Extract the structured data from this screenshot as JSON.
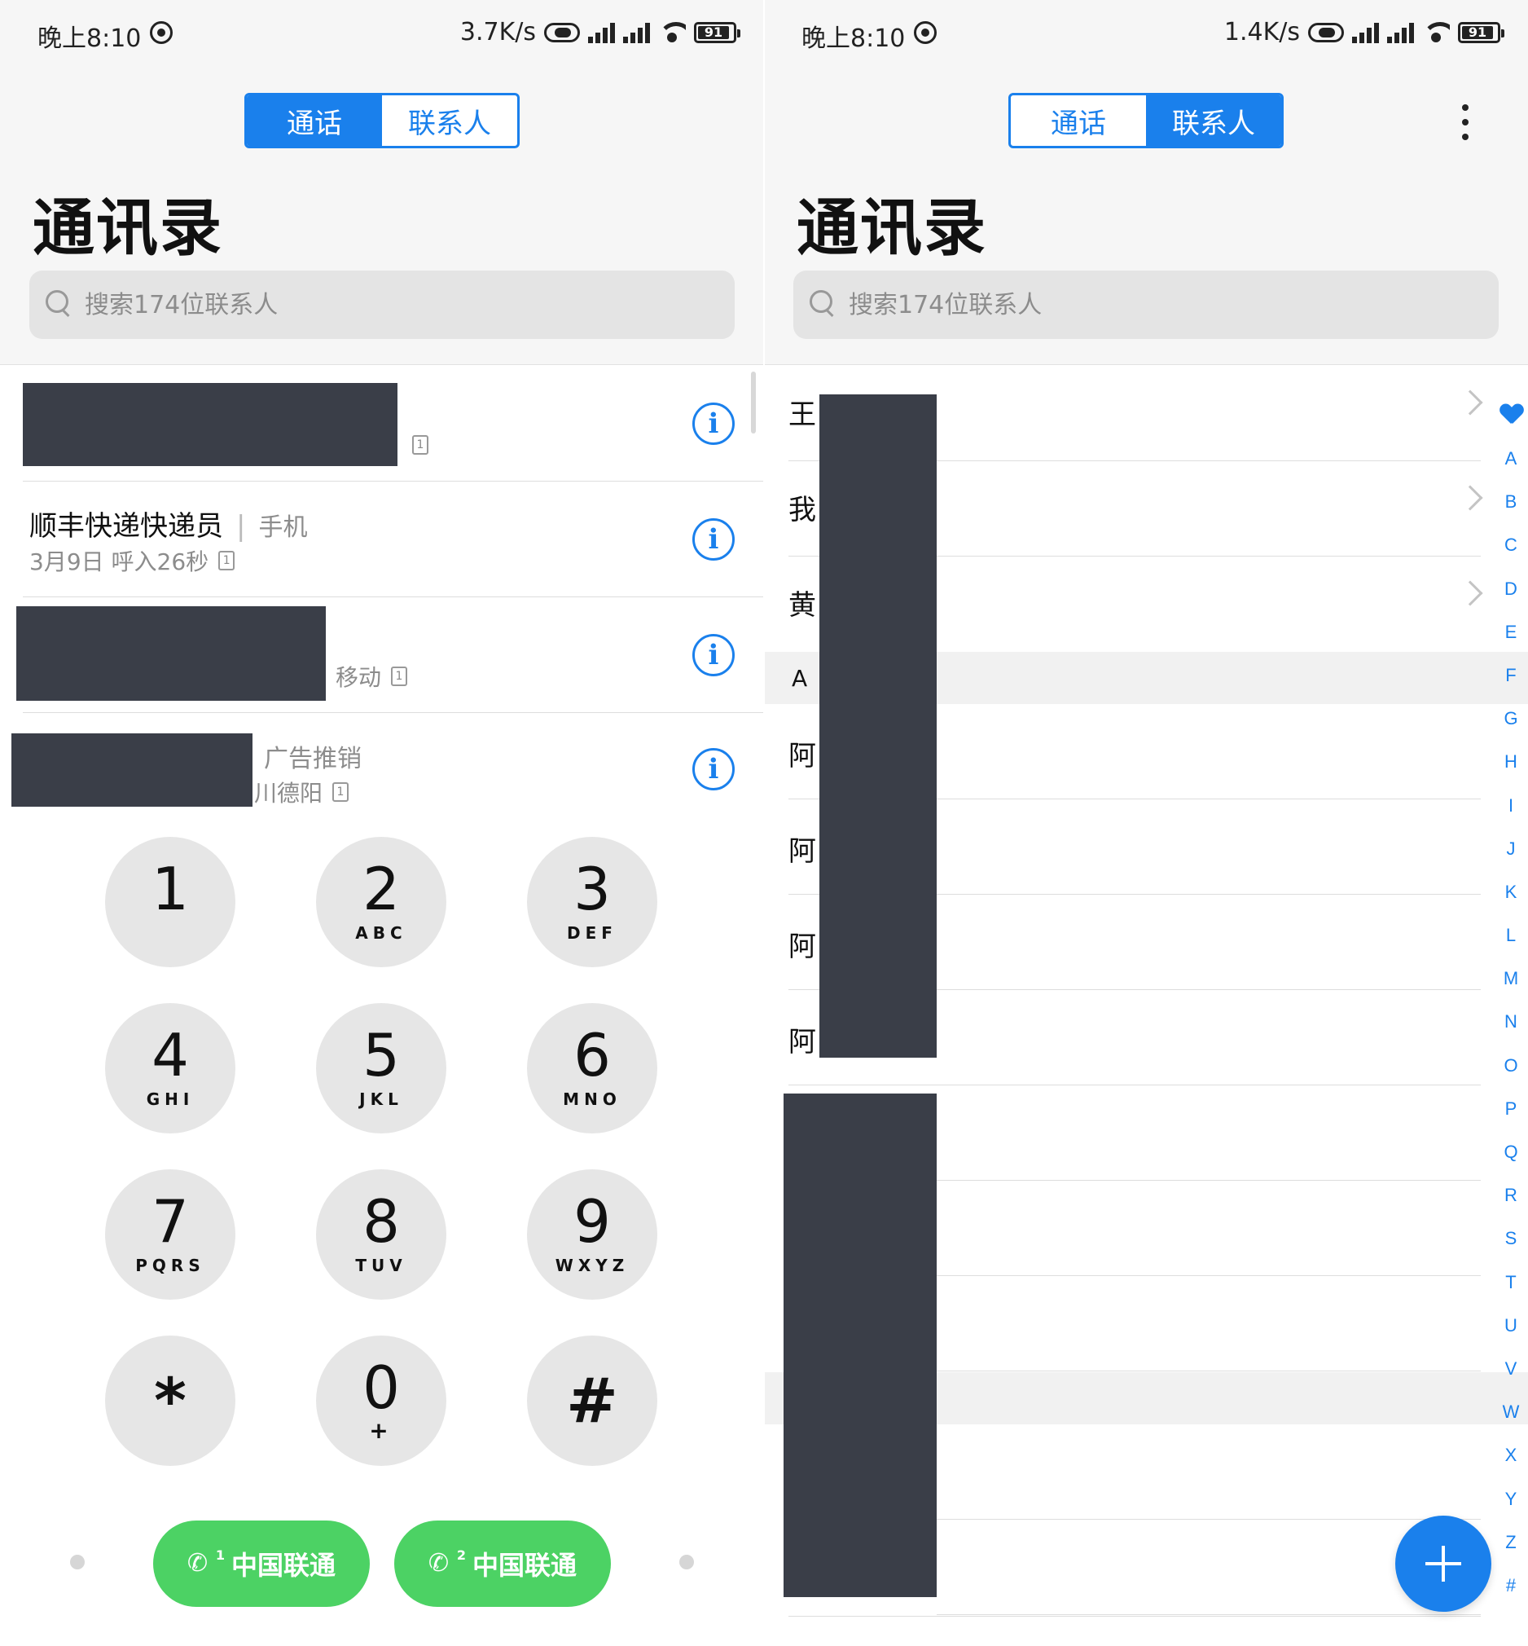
{
  "status_left": {
    "time": "晚上8:10",
    "speed": "3.7K/s",
    "battery": "91"
  },
  "status_right": {
    "time": "晚上8:10",
    "speed": "1.4K/s",
    "battery": "91"
  },
  "tabs": {
    "calls": "通话",
    "contacts": "联系人"
  },
  "title": "通讯录",
  "search": {
    "placeholder": "搜索174位联系人"
  },
  "call_log": [
    {
      "name": "",
      "type": "",
      "detail": "",
      "sim": "1"
    },
    {
      "name": "顺丰快递快递员",
      "type": "手机",
      "detail": "3月9日 呼入26秒",
      "sim": "1"
    },
    {
      "name": "",
      "type": "",
      "detail": "移动",
      "sim": "1"
    },
    {
      "name": "",
      "type": "广告推销",
      "detail": "川德阳",
      "sim": "1"
    }
  ],
  "keypad": [
    {
      "digit": "1",
      "letters": ""
    },
    {
      "digit": "2",
      "letters": "ABC"
    },
    {
      "digit": "3",
      "letters": "DEF"
    },
    {
      "digit": "4",
      "letters": "GHI"
    },
    {
      "digit": "5",
      "letters": "JKL"
    },
    {
      "digit": "6",
      "letters": "MNO"
    },
    {
      "digit": "7",
      "letters": "PQRS"
    },
    {
      "digit": "8",
      "letters": "TUV"
    },
    {
      "digit": "9",
      "letters": "WXYZ"
    },
    {
      "digit": "*",
      "letters": ""
    },
    {
      "digit": "0",
      "letters": "+"
    },
    {
      "digit": "#",
      "letters": ""
    }
  ],
  "sim_buttons": [
    {
      "label": "中国联通",
      "sim": "1"
    },
    {
      "label": "中国联通",
      "sim": "2"
    }
  ],
  "contacts": {
    "starred": [
      "王",
      "我",
      "黄"
    ],
    "section_a": "A",
    "a_names": [
      "阿",
      "阿",
      "阿",
      "阿"
    ]
  },
  "az_index": [
    "A",
    "B",
    "C",
    "D",
    "E",
    "F",
    "G",
    "H",
    "I",
    "J",
    "K",
    "L",
    "M",
    "N",
    "O",
    "P",
    "Q",
    "R",
    "S",
    "T",
    "U",
    "V",
    "W",
    "X",
    "Y",
    "Z",
    "#"
  ],
  "colors": {
    "accent": "#1a80ec",
    "call_green": "#4cd264",
    "redaction": "#3a3e48"
  }
}
